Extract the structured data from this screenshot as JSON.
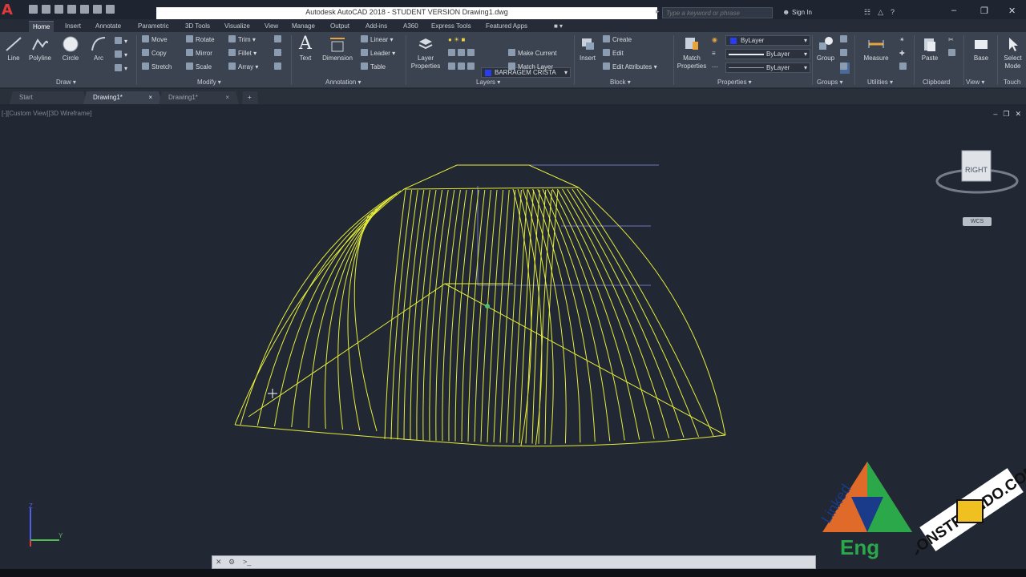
{
  "titlebar": {
    "app_logo": "A",
    "title": "Autodesk AutoCAD 2018 - STUDENT VERSION    Drawing1.dwg",
    "search_placeholder": "Type a keyword or phrase",
    "sign_in": "Sign In"
  },
  "ribbon_tabs": [
    "Home",
    "Insert",
    "Annotate",
    "Parametric",
    "3D Tools",
    "Visualize",
    "View",
    "Manage",
    "Output",
    "Add-ins",
    "A360",
    "Express Tools",
    "Featured Apps"
  ],
  "draw": {
    "title": "Draw ▾",
    "line": "Line",
    "polyline": "Polyline",
    "circle": "Circle",
    "arc": "Arc"
  },
  "modify": {
    "title": "Modify ▾",
    "move": "Move",
    "rotate": "Rotate",
    "trim": "Trim ▾",
    "copy": "Copy",
    "mirror": "Mirror",
    "fillet": "Fillet ▾",
    "stretch": "Stretch",
    "scale": "Scale",
    "array": "Array ▾"
  },
  "annotation": {
    "title": "Annotation ▾",
    "text": "Text",
    "dimension": "Dimension",
    "linear": "Linear ▾",
    "leader": "Leader ▾",
    "table": "Table"
  },
  "layers": {
    "title": "Layers ▾",
    "layer_properties": "Layer Properties",
    "current_layer": "BARRAGEM CRISTA",
    "make_current": "Make Current",
    "match_layer": "Match Layer"
  },
  "block": {
    "title": "Block ▾",
    "insert": "Insert",
    "create": "Create",
    "edit": "Edit",
    "edit_attributes": "Edit Attributes ▾"
  },
  "properties": {
    "title": "Properties ▾",
    "match_properties": "Match Properties",
    "color": "ByLayer",
    "lineweight": "ByLayer",
    "linetype": "ByLayer"
  },
  "groups": {
    "title": "Groups ▾",
    "group": "Group"
  },
  "utilities": {
    "title": "Utilities ▾",
    "measure": "Measure"
  },
  "clipboard": {
    "title": "Clipboard",
    "paste": "Paste"
  },
  "view_panel": {
    "title": "View ▾",
    "base": "Base"
  },
  "touch": {
    "title": "Touch",
    "select_mode": "Select Mode"
  },
  "file_tabs": [
    "Start",
    "Drawing1*",
    "Drawing1*"
  ],
  "viewport": {
    "label": "[-][Custom View][3D Wireframe]",
    "viewcube_face": "RIGHT",
    "wcs": "WCS"
  },
  "ucs": {
    "z": "Z",
    "y": "Y"
  },
  "command_line": {
    "placeholder": ""
  },
  "watermarks": {
    "linkedeng_top": "Linked",
    "linkedeng_bottom": "Eng",
    "constru": "CONSTRUINDO.COM"
  },
  "colors": {
    "accent_blue": "#2a3cf0",
    "wire_yellow": "#e6ee3a",
    "ribbon_bg": "#3b4350",
    "canvas_bg": "#212733"
  }
}
